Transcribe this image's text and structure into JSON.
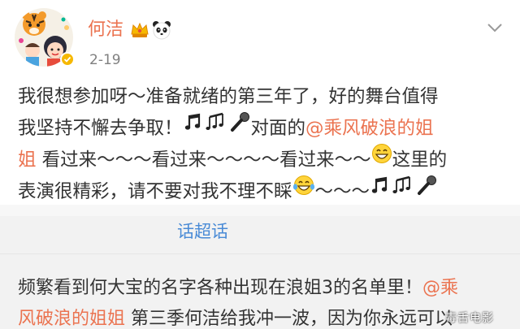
{
  "header": {
    "user_name": "何洁",
    "post_time": "2-19"
  },
  "post": {
    "line1": "我很想参加呀～准备就绪的第三年了，好的舞台值得",
    "line2_a": "我坚持不懈去争取！",
    "line2_b": "对面的",
    "line2_mention": "@乘风破浪的姐",
    "line3_mention": "姐",
    "line3_b": " 看过来～～～看过来～～～～看过来～～",
    "line3_c": "这里的",
    "line4_a": "表演很精彩，请不要对我不理不睬",
    "line4_b": "～～～"
  },
  "repost": {
    "supertopic_label": "话超话",
    "line1_a": "频繁看到何大宝的名字各种出现在浪姐3的名单里！",
    "line1_mention": "@乘",
    "line2_mention": "风破浪的姐姐",
    "line2_b": " 第三季何洁给我冲一波，因为你永远可以"
  },
  "watermark": "毒舌电影",
  "icons": {
    "verified": "verified-badge-icon",
    "vip": "vip-crown-icon",
    "panda": "panda-icon",
    "menu": "chevron-down-icon",
    "music_note": "music-note-icon",
    "music_notes": "music-notes-icon",
    "microphone": "microphone-icon",
    "grin": "grinning-face-icon",
    "laugh": "tears-of-joy-icon"
  },
  "colors": {
    "name": "#eb7350",
    "mention": "#eb7350",
    "text": "#333333",
    "meta": "#808080",
    "supertopic": "#4a8bd6",
    "repost_bg": "#f2f2f2"
  }
}
